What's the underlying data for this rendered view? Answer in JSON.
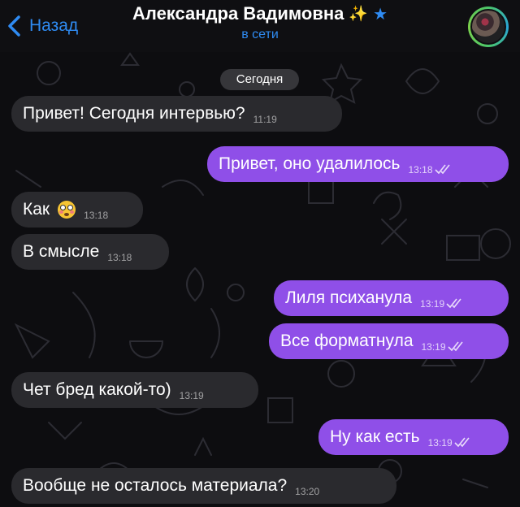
{
  "header": {
    "back_label": "Назад",
    "contact_name": "Александра Вадимовна",
    "name_emoji": "✨",
    "favorite_star": "★",
    "status": "в сети",
    "avatar_icon": "avatar-photo"
  },
  "chat": {
    "date_chip": "Сегодня",
    "messages": [
      {
        "direction": "in",
        "text": "Привет! Сегодня интервью?",
        "time": "11:19"
      },
      {
        "direction": "out",
        "text": "Привет, оно удалилось",
        "time": "13:18",
        "status": "read"
      },
      {
        "direction": "in",
        "text": "Как",
        "emoji": "flushed-face",
        "time": "13:18"
      },
      {
        "direction": "in",
        "text": "В смысле",
        "time": "13:18"
      },
      {
        "direction": "out",
        "text": "Лиля психанула",
        "time": "13:19",
        "status": "read"
      },
      {
        "direction": "out",
        "text": "Все форматнула",
        "time": "13:19",
        "status": "read"
      },
      {
        "direction": "in",
        "text": "Чет бред какой-то)",
        "time": "13:19"
      },
      {
        "direction": "out",
        "text": "Ну как есть",
        "time": "13:19",
        "status": "read"
      },
      {
        "direction": "in",
        "text": "Вообще не осталось материала?",
        "time": "13:20"
      }
    ]
  },
  "colors": {
    "accent": "#2f8bf2",
    "outgoing_bubble": "#8f4fe8",
    "incoming_bubble": "#2a2a2e",
    "background": "#0d0d10"
  }
}
